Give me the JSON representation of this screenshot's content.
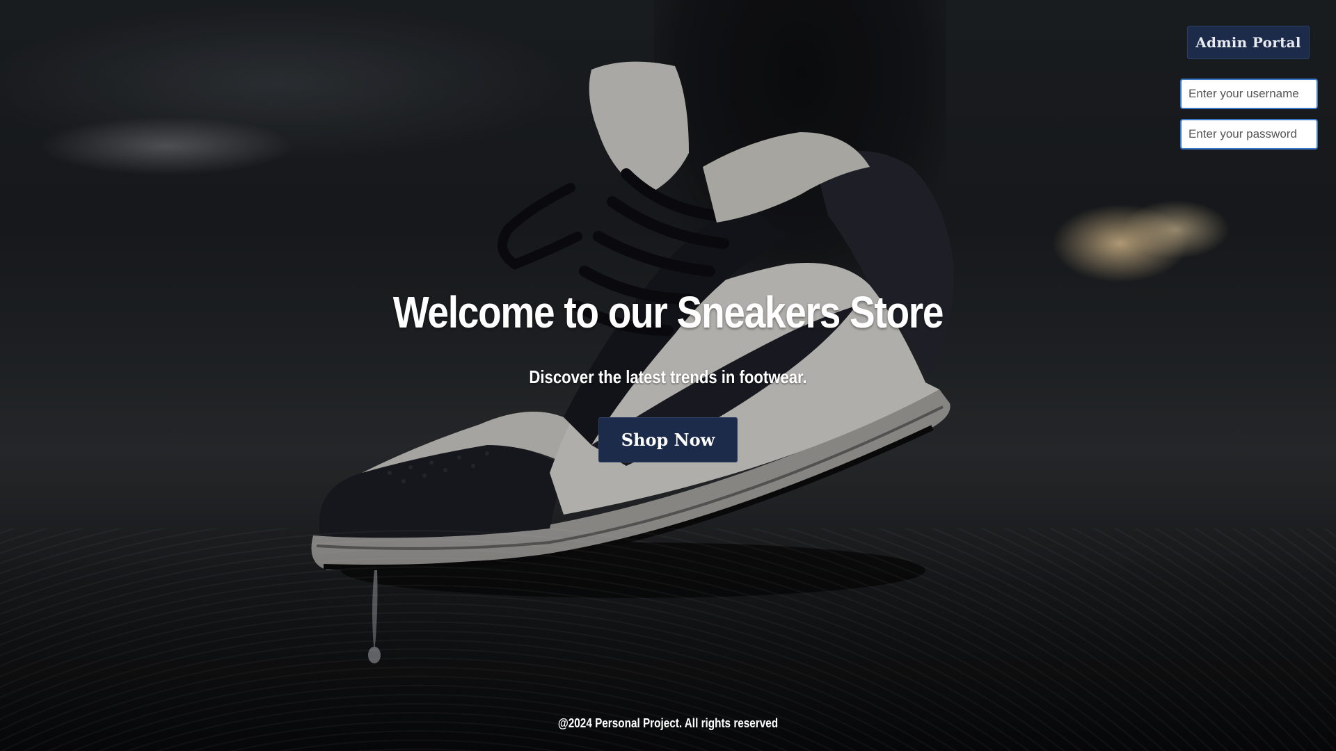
{
  "header": {
    "admin_button_label": "Admin Portal",
    "username_placeholder": "Enter your username",
    "password_placeholder": "Enter your password"
  },
  "hero": {
    "title": "Welcome to our Sneakers Store",
    "subtitle": "Discover the latest trends in footwear.",
    "cta_label": "Shop Now"
  },
  "footer": {
    "text": "@2024 Personal Project. All rights reserved"
  },
  "colors": {
    "button_bg": "#1d2b4a",
    "input_border": "#3a78c9",
    "text": "#ffffff"
  }
}
